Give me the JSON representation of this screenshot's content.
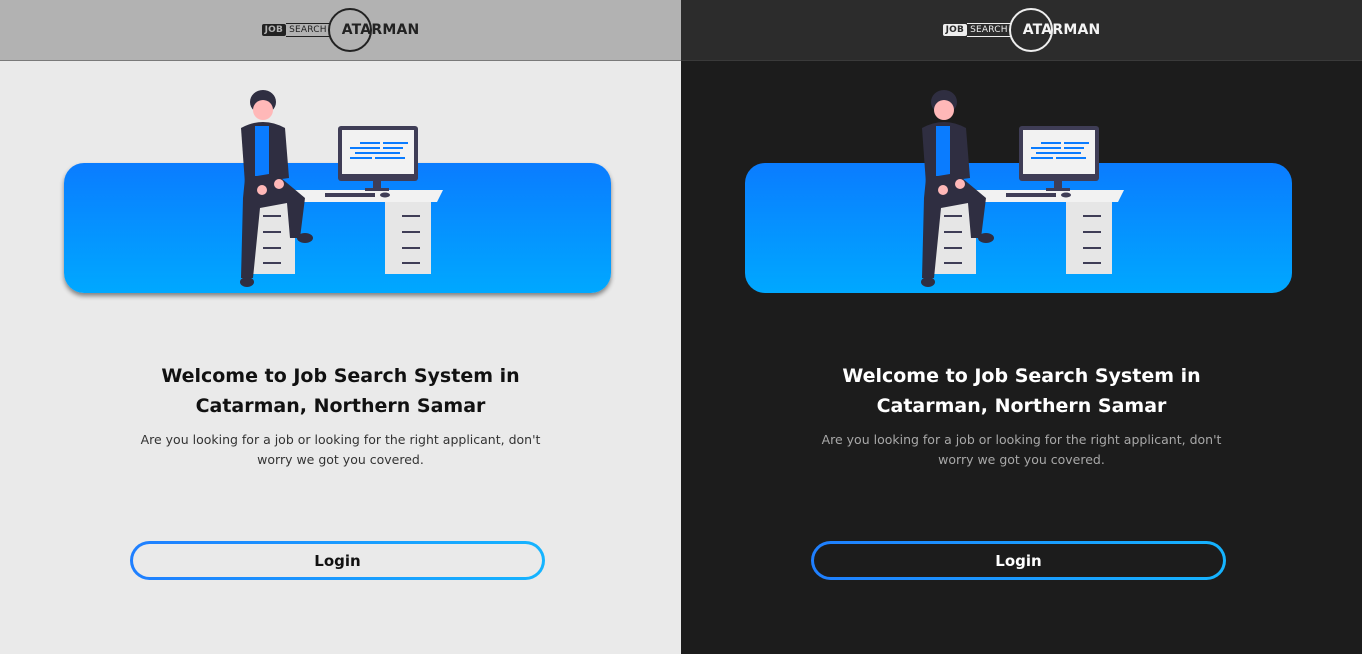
{
  "brand": {
    "logo_job": "JOB",
    "logo_search": "SEARCH",
    "logo_name": "ATARMAN"
  },
  "panels": [
    {
      "theme": "light",
      "title": "Welcome to Job Search System in Catarman, Northern Samar",
      "subtitle": "Are you looking for a job or looking for the right applicant, don't worry we got you covered.",
      "login_label": "Login"
    },
    {
      "theme": "dark",
      "title": "Welcome to Job Search System in Catarman, Northern Samar",
      "subtitle": "Are you looking for a job or looking for the right applicant, don't worry we got you covered.",
      "login_label": "Login"
    }
  ],
  "colors": {
    "accent_start": "#0a7cff",
    "accent_end": "#00a8ff",
    "light_bg": "#eaeaea",
    "dark_bg": "#1c1c1c"
  },
  "icons": {
    "hero": "person-sitting-at-desk-illustration"
  }
}
